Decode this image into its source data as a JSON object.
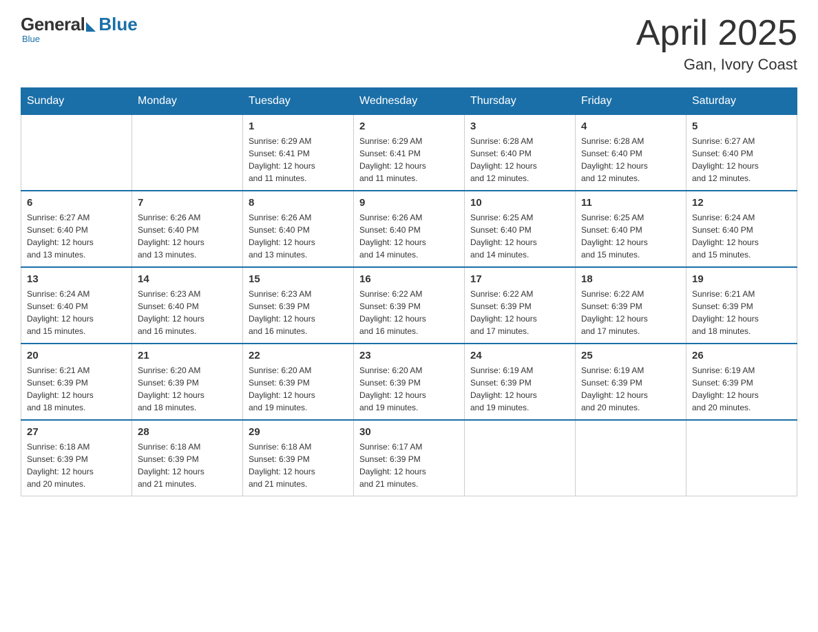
{
  "logo": {
    "general": "General",
    "blue": "Blue",
    "subtitle": "Blue"
  },
  "title": "April 2025",
  "subtitle": "Gan, Ivory Coast",
  "weekdays": [
    "Sunday",
    "Monday",
    "Tuesday",
    "Wednesday",
    "Thursday",
    "Friday",
    "Saturday"
  ],
  "weeks": [
    [
      {
        "day": "",
        "info": ""
      },
      {
        "day": "",
        "info": ""
      },
      {
        "day": "1",
        "info": "Sunrise: 6:29 AM\nSunset: 6:41 PM\nDaylight: 12 hours\nand 11 minutes."
      },
      {
        "day": "2",
        "info": "Sunrise: 6:29 AM\nSunset: 6:41 PM\nDaylight: 12 hours\nand 11 minutes."
      },
      {
        "day": "3",
        "info": "Sunrise: 6:28 AM\nSunset: 6:40 PM\nDaylight: 12 hours\nand 12 minutes."
      },
      {
        "day": "4",
        "info": "Sunrise: 6:28 AM\nSunset: 6:40 PM\nDaylight: 12 hours\nand 12 minutes."
      },
      {
        "day": "5",
        "info": "Sunrise: 6:27 AM\nSunset: 6:40 PM\nDaylight: 12 hours\nand 12 minutes."
      }
    ],
    [
      {
        "day": "6",
        "info": "Sunrise: 6:27 AM\nSunset: 6:40 PM\nDaylight: 12 hours\nand 13 minutes."
      },
      {
        "day": "7",
        "info": "Sunrise: 6:26 AM\nSunset: 6:40 PM\nDaylight: 12 hours\nand 13 minutes."
      },
      {
        "day": "8",
        "info": "Sunrise: 6:26 AM\nSunset: 6:40 PM\nDaylight: 12 hours\nand 13 minutes."
      },
      {
        "day": "9",
        "info": "Sunrise: 6:26 AM\nSunset: 6:40 PM\nDaylight: 12 hours\nand 14 minutes."
      },
      {
        "day": "10",
        "info": "Sunrise: 6:25 AM\nSunset: 6:40 PM\nDaylight: 12 hours\nand 14 minutes."
      },
      {
        "day": "11",
        "info": "Sunrise: 6:25 AM\nSunset: 6:40 PM\nDaylight: 12 hours\nand 15 minutes."
      },
      {
        "day": "12",
        "info": "Sunrise: 6:24 AM\nSunset: 6:40 PM\nDaylight: 12 hours\nand 15 minutes."
      }
    ],
    [
      {
        "day": "13",
        "info": "Sunrise: 6:24 AM\nSunset: 6:40 PM\nDaylight: 12 hours\nand 15 minutes."
      },
      {
        "day": "14",
        "info": "Sunrise: 6:23 AM\nSunset: 6:40 PM\nDaylight: 12 hours\nand 16 minutes."
      },
      {
        "day": "15",
        "info": "Sunrise: 6:23 AM\nSunset: 6:39 PM\nDaylight: 12 hours\nand 16 minutes."
      },
      {
        "day": "16",
        "info": "Sunrise: 6:22 AM\nSunset: 6:39 PM\nDaylight: 12 hours\nand 16 minutes."
      },
      {
        "day": "17",
        "info": "Sunrise: 6:22 AM\nSunset: 6:39 PM\nDaylight: 12 hours\nand 17 minutes."
      },
      {
        "day": "18",
        "info": "Sunrise: 6:22 AM\nSunset: 6:39 PM\nDaylight: 12 hours\nand 17 minutes."
      },
      {
        "day": "19",
        "info": "Sunrise: 6:21 AM\nSunset: 6:39 PM\nDaylight: 12 hours\nand 18 minutes."
      }
    ],
    [
      {
        "day": "20",
        "info": "Sunrise: 6:21 AM\nSunset: 6:39 PM\nDaylight: 12 hours\nand 18 minutes."
      },
      {
        "day": "21",
        "info": "Sunrise: 6:20 AM\nSunset: 6:39 PM\nDaylight: 12 hours\nand 18 minutes."
      },
      {
        "day": "22",
        "info": "Sunrise: 6:20 AM\nSunset: 6:39 PM\nDaylight: 12 hours\nand 19 minutes."
      },
      {
        "day": "23",
        "info": "Sunrise: 6:20 AM\nSunset: 6:39 PM\nDaylight: 12 hours\nand 19 minutes."
      },
      {
        "day": "24",
        "info": "Sunrise: 6:19 AM\nSunset: 6:39 PM\nDaylight: 12 hours\nand 19 minutes."
      },
      {
        "day": "25",
        "info": "Sunrise: 6:19 AM\nSunset: 6:39 PM\nDaylight: 12 hours\nand 20 minutes."
      },
      {
        "day": "26",
        "info": "Sunrise: 6:19 AM\nSunset: 6:39 PM\nDaylight: 12 hours\nand 20 minutes."
      }
    ],
    [
      {
        "day": "27",
        "info": "Sunrise: 6:18 AM\nSunset: 6:39 PM\nDaylight: 12 hours\nand 20 minutes."
      },
      {
        "day": "28",
        "info": "Sunrise: 6:18 AM\nSunset: 6:39 PM\nDaylight: 12 hours\nand 21 minutes."
      },
      {
        "day": "29",
        "info": "Sunrise: 6:18 AM\nSunset: 6:39 PM\nDaylight: 12 hours\nand 21 minutes."
      },
      {
        "day": "30",
        "info": "Sunrise: 6:17 AM\nSunset: 6:39 PM\nDaylight: 12 hours\nand 21 minutes."
      },
      {
        "day": "",
        "info": ""
      },
      {
        "day": "",
        "info": ""
      },
      {
        "day": "",
        "info": ""
      }
    ]
  ]
}
